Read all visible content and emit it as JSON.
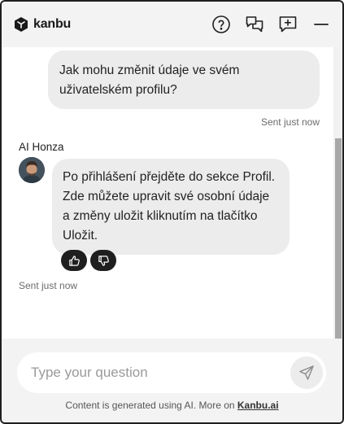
{
  "header": {
    "brand": "kanbu",
    "actions": [
      {
        "name": "help-icon"
      },
      {
        "name": "conversations-icon"
      },
      {
        "name": "new-chat-icon"
      },
      {
        "name": "minimize-icon"
      }
    ]
  },
  "messages": {
    "user": {
      "text": "Jak mohu změnit údaje ve svém uživatelském profilu?",
      "status": "Sent just now"
    },
    "bot": {
      "name": "AI Honza",
      "text": "Po přihlášení přejděte do sekce Profil. Zde můžete upravit své osobní údaje a změny uložit kliknutím na tlačítko Uložit.",
      "status": "Sent just now",
      "feedback": [
        {
          "name": "thumbs-up-icon"
        },
        {
          "name": "thumbs-down-icon"
        }
      ]
    }
  },
  "composer": {
    "placeholder": "Type your question",
    "value": ""
  },
  "disclaimer": {
    "text": "Content is generated using AI. More on ",
    "link": "Kanbu.ai"
  },
  "colors": {
    "header_bg": "#f3f3f4",
    "bubble_bg": "#ececec",
    "feedback_bg": "#1f1f1f",
    "scrollbar_thumb": "#a8a8a8"
  }
}
